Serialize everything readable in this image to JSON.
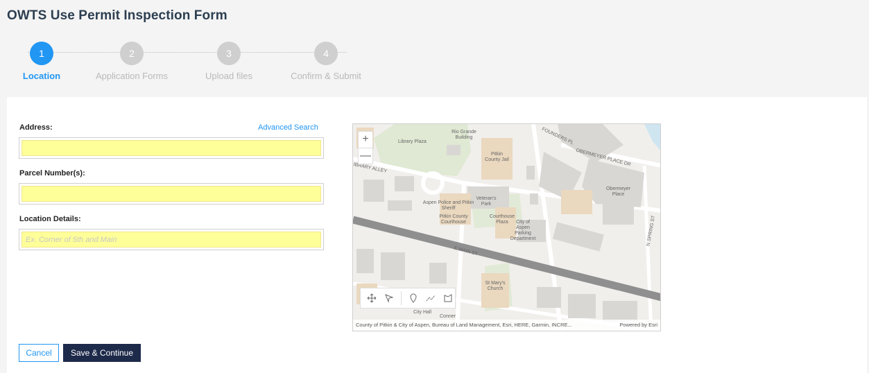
{
  "title": "OWTS Use Permit Inspection Form",
  "steps": [
    {
      "number": "1",
      "label": "Location",
      "state": "active"
    },
    {
      "number": "2",
      "label": "Application Forms",
      "state": "inactive"
    },
    {
      "number": "3",
      "label": "Upload files",
      "state": "inactive"
    },
    {
      "number": "4",
      "label": "Confirm & Submit",
      "state": "inactive"
    }
  ],
  "form": {
    "address_label": "Address:",
    "advanced_search": "Advanced Search",
    "address_value": "",
    "parcel_label": "Parcel Number(s):",
    "parcel_value": "",
    "location_label": "Location Details:",
    "location_value": "",
    "location_placeholder": "Ex. Corner of 5th and Main"
  },
  "map": {
    "labels": {
      "library_plaza": "Library Plaza",
      "rio_grande": "Rio Grande Building",
      "founders_pl": "FOUNDERS PL",
      "obermeyer_place_dr": "OBERMEYER PLACE DR",
      "library_alley": "IBRARY ALLEY",
      "pitkin_county_jail": "Pitkin County Jail",
      "obermeyer_place": "Obermeyer Place",
      "aspen_police": "Aspen Police and Pitkin Sheriff",
      "veterans_park": "Veteran's Park",
      "pitkin_courthouse": "Pitkin County Courthouse",
      "courthouse_plaza": "Courthouse Plaza",
      "city_parking": "City of Aspen Parking Department",
      "e_main_st": "E MAIN ST",
      "n_spring_st": "N SPRING ST",
      "st_marys": "St Mary's Church",
      "city_hall": "City Hall",
      "conner": "Conner"
    },
    "zoom_in": "+",
    "zoom_out": "—",
    "attribution": "County of Pitkin & City of Aspen, Bureau of Land Management, Esri, HERE, Garmin, INCRE...",
    "powered_by": "Powered by Esri"
  },
  "buttons": {
    "cancel": "Cancel",
    "save_continue": "Save & Continue"
  },
  "colors": {
    "accent": "#2196f3",
    "primary_button": "#1e2a4a",
    "field_highlight": "#ffff99"
  }
}
